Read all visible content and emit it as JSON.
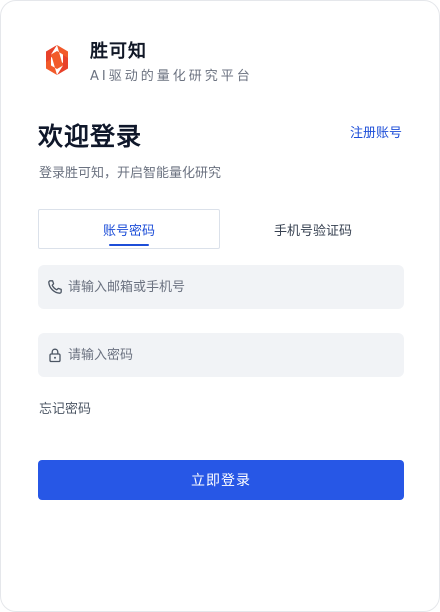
{
  "brand": {
    "name": "胜可知",
    "slogan": "AI驱动的量化研究平台",
    "logo_icon": "s-hexagon-logo",
    "logo_color": "#ef4923"
  },
  "header": {
    "title": "欢迎登录",
    "register_link": "注册账号",
    "subtitle": "登录胜可知，开启智能量化研究"
  },
  "tabs": [
    {
      "label": "账号密码",
      "active": true
    },
    {
      "label": "手机号验证码",
      "active": false
    }
  ],
  "form": {
    "account": {
      "placeholder": "请输入邮箱或手机号",
      "value": "",
      "icon": "phone-icon"
    },
    "password": {
      "placeholder": "请输入密码",
      "value": "",
      "icon": "lock-icon"
    },
    "forgot_link": "忘记密码",
    "submit_label": "立即登录"
  },
  "colors": {
    "accent": "#1d4ed8",
    "button": "#2757e6",
    "field_bg": "#f1f3f6"
  }
}
